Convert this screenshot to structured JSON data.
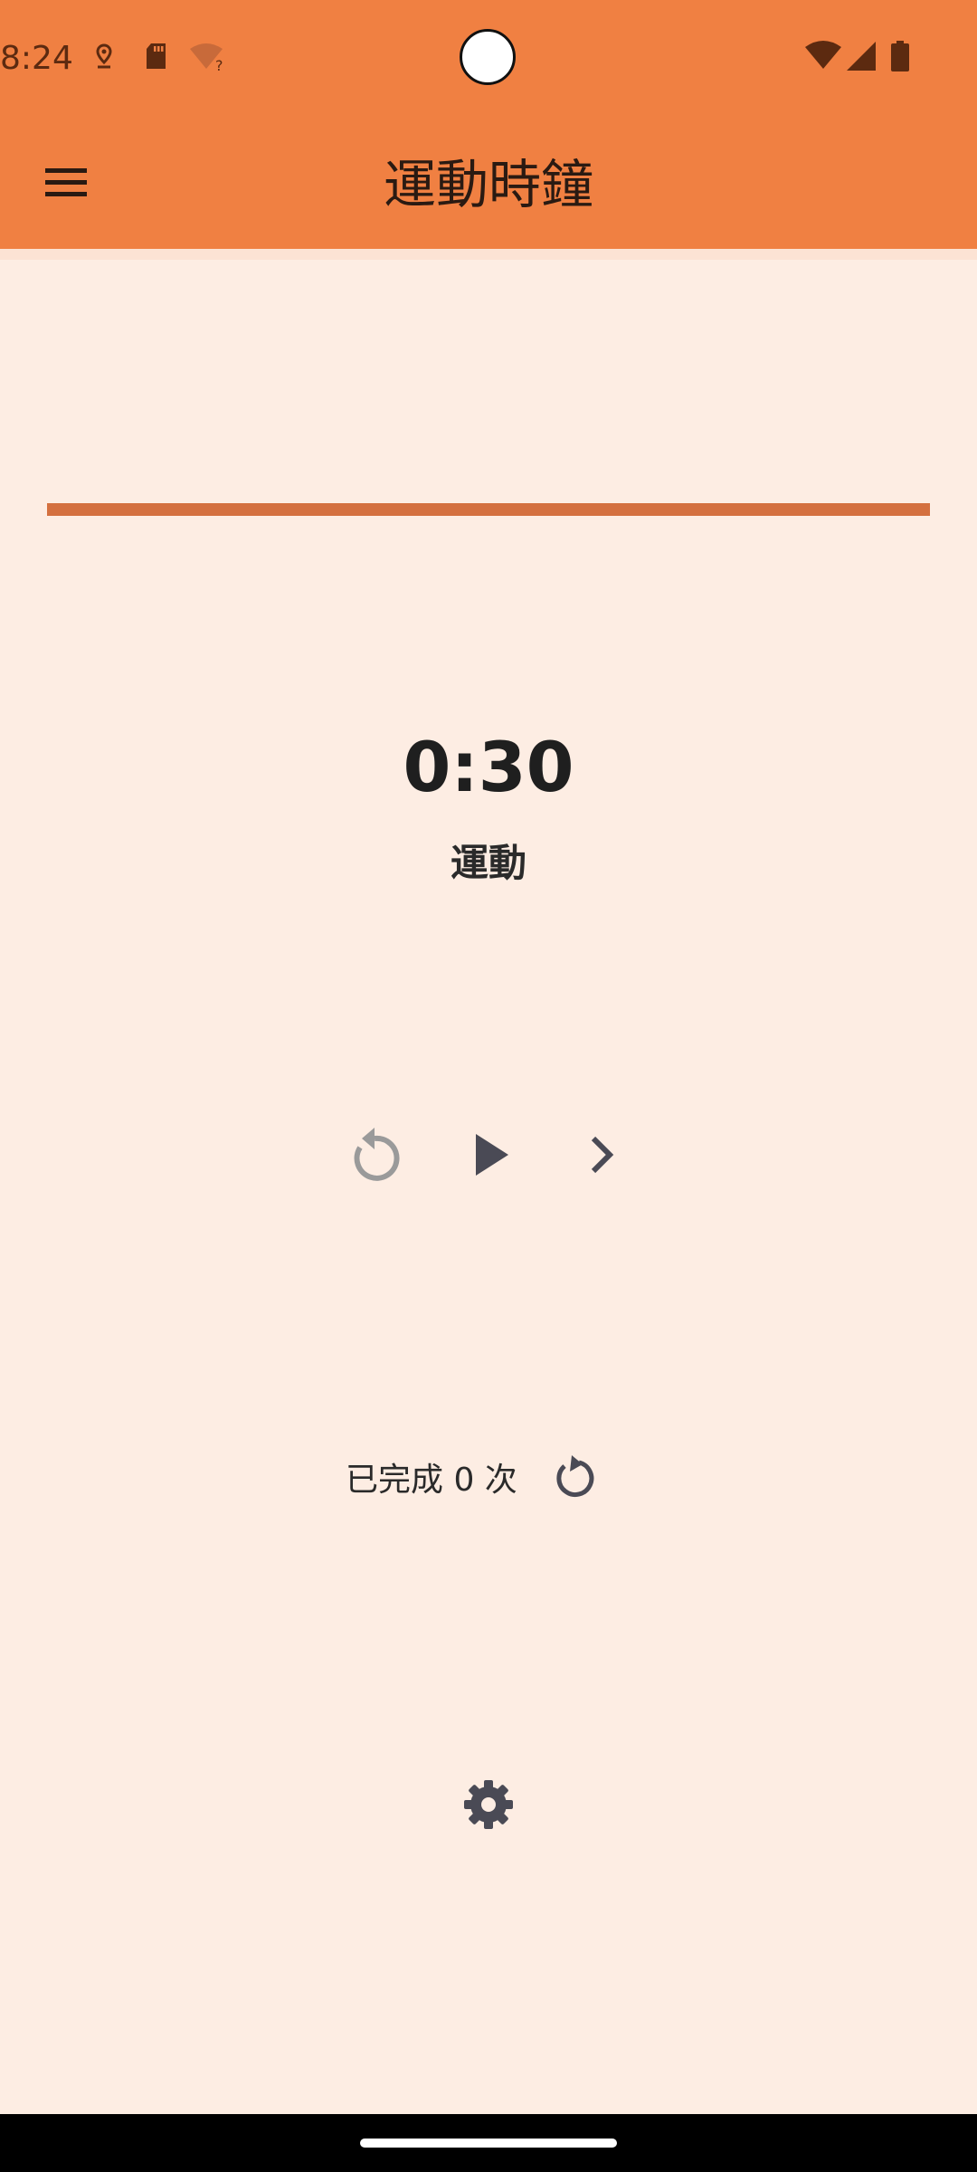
{
  "status_bar": {
    "time": "8:24",
    "icons_left": [
      "location-pin-icon",
      "sd-card-icon",
      "wifi-unknown-icon"
    ],
    "icons_right": [
      "wifi-icon",
      "cellular-signal-icon",
      "battery-icon"
    ]
  },
  "toolbar": {
    "menu_icon": "menu-icon",
    "title": "運動時鐘"
  },
  "progress": {
    "value": 1.0
  },
  "timer": {
    "value": "0:30",
    "phase": "運動"
  },
  "controls": {
    "reset_icon": "replay-icon",
    "play_icon": "play-icon",
    "next_icon": "chevron-right-icon"
  },
  "completed": {
    "text": "已完成 0 次",
    "reset_icon": "refresh-icon"
  },
  "settings": {
    "icon": "gear-icon"
  },
  "colors": {
    "header": "#F08042",
    "background": "#FDEDE3",
    "progress": "#D4703F",
    "icon_dark": "#4A4A55",
    "icon_disabled": "#9A9A9A"
  }
}
